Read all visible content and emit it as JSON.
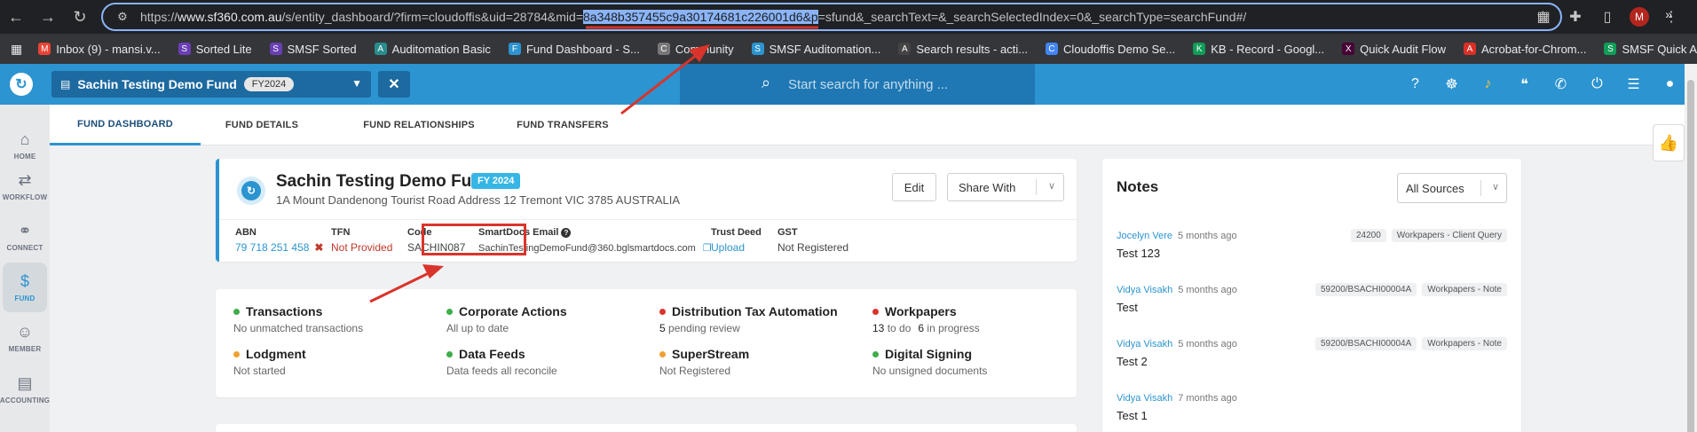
{
  "browser": {
    "url_prefix": "https://",
    "url_host": "www.sf360.com.au",
    "url_path": "/s/entity_dashboard/?firm=cloudoffis&uid=28784&mid=",
    "url_selected": "8a348b357455c9a30174681c226001d6&p",
    "url_suffix": "=sfund&_searchText=&_searchSelectedIndex=0&_searchType=searchFund#/",
    "profile_initial": "M"
  },
  "bookmarks": [
    {
      "label": "Inbox (9) - mansi.v...",
      "color": "#ea4335",
      "icon": "M"
    },
    {
      "label": "Sorted Lite",
      "color": "#6a3fb5",
      "icon": "S"
    },
    {
      "label": "SMSF Sorted",
      "color": "#6a3fb5",
      "icon": "S"
    },
    {
      "label": "Auditomation Basic",
      "color": "#2a8c8c",
      "icon": "A"
    },
    {
      "label": "Fund Dashboard - S...",
      "color": "#2c94d0",
      "icon": "F"
    },
    {
      "label": "Community",
      "color": "#777777",
      "icon": "C"
    },
    {
      "label": "SMSF Auditomation...",
      "color": "#2c94d0",
      "icon": "S"
    },
    {
      "label": "Search results - acti...",
      "color": "#444444",
      "icon": "A"
    },
    {
      "label": "Cloudoffis Demo Se...",
      "color": "#4285f4",
      "icon": "C"
    },
    {
      "label": "KB - Record - Googl...",
      "color": "#0f9d58",
      "icon": "K"
    },
    {
      "label": "Quick Audit Flow",
      "color": "#470137",
      "icon": "X"
    },
    {
      "label": "Acrobat-for-Chrom...",
      "color": "#d93025",
      "icon": "A"
    },
    {
      "label": "SMSF Quick Audit P...",
      "color": "#0f9d58",
      "icon": "S"
    }
  ],
  "header": {
    "fund_name": "Sachin Testing Demo Fund",
    "fund_year": "FY2024",
    "search_placeholder": "Start search for anything ..."
  },
  "sidebar": [
    {
      "label": "HOME",
      "icon": "⌂",
      "active": false
    },
    {
      "label": "WORKFLOW",
      "icon": "⇄",
      "active": false
    },
    {
      "label": "CONNECT",
      "icon": "⚭",
      "active": false
    },
    {
      "label": "FUND",
      "icon": "$",
      "active": true
    },
    {
      "label": "MEMBER",
      "icon": "☺",
      "active": false
    },
    {
      "label": "ACCOUNTING",
      "icon": "▤",
      "active": false
    }
  ],
  "tabs": [
    {
      "label": "FUND DASHBOARD",
      "active": true
    },
    {
      "label": "FUND DETAILS",
      "active": false
    },
    {
      "label": "FUND RELATIONSHIPS",
      "active": false
    },
    {
      "label": "FUND TRANSFERS",
      "active": false
    }
  ],
  "fund": {
    "name": "Sachin Testing Demo Fund",
    "fy_badge": "FY 2024",
    "address": "1A Mount Dandenong Tourist Road Address 12 Tremont VIC 3785 AUSTRALIA",
    "edit_label": "Edit",
    "share_label": "Share With",
    "abn_label": "ABN",
    "abn_value": "79 718 251 458",
    "tfn_label": "TFN",
    "tfn_value": "Not Provided",
    "code_label": "Code",
    "code_value": "SACHIN087",
    "smartdocs_label": "SmartDocs Email",
    "smartdocs_value": "SachinTestingDemoFund@360.bglsmartdocs.com",
    "trustdeed_label": "Trust Deed",
    "trustdeed_value": "Upload",
    "gst_label": "GST",
    "gst_value": "Not Registered"
  },
  "statuses": [
    {
      "title": "Transactions",
      "sub": "No unmatched transactions",
      "color": "#3dae49"
    },
    {
      "title": "Corporate Actions",
      "sub": "All up to date",
      "color": "#3dae49"
    },
    {
      "title": "Distribution Tax Automation",
      "sub_num": "5",
      "sub": "pending review",
      "color": "#d9342b"
    },
    {
      "title": "Workpapers",
      "sub_num": "13",
      "sub": "to do",
      "sub_num2": "6",
      "sub2": "in progress",
      "color": "#d9342b"
    },
    {
      "title": "Lodgment",
      "sub": "Not started",
      "color": "#f0a030"
    },
    {
      "title": "Data Feeds",
      "sub": "Data feeds all reconcile",
      "color": "#3dae49"
    },
    {
      "title": "SuperStream",
      "sub": "Not Registered",
      "color": "#f0a030"
    },
    {
      "title": "Digital Signing",
      "sub": "No unsigned documents",
      "color": "#3dae49"
    }
  ],
  "notes": {
    "title": "Notes",
    "filter": "All Sources",
    "items": [
      {
        "author": "Jocelyn Vere",
        "time": "5 months ago",
        "tags": [
          "24200",
          "Workpapers - Client Query"
        ],
        "text": "Test 123"
      },
      {
        "author": "Vidya Visakh",
        "time": "5 months ago",
        "tags": [
          "59200/BSACHI00004A",
          "Workpapers - Note"
        ],
        "text": "Test"
      },
      {
        "author": "Vidya Visakh",
        "time": "5 months ago",
        "tags": [
          "59200/BSACHI00004A",
          "Workpapers - Note"
        ],
        "text": "Test 2"
      },
      {
        "author": "Vidya Visakh",
        "time": "7 months ago",
        "tags": [],
        "text": "Test 1"
      }
    ]
  },
  "colors": {
    "brand": "#2c94d0",
    "annotation": "#d9342b"
  }
}
